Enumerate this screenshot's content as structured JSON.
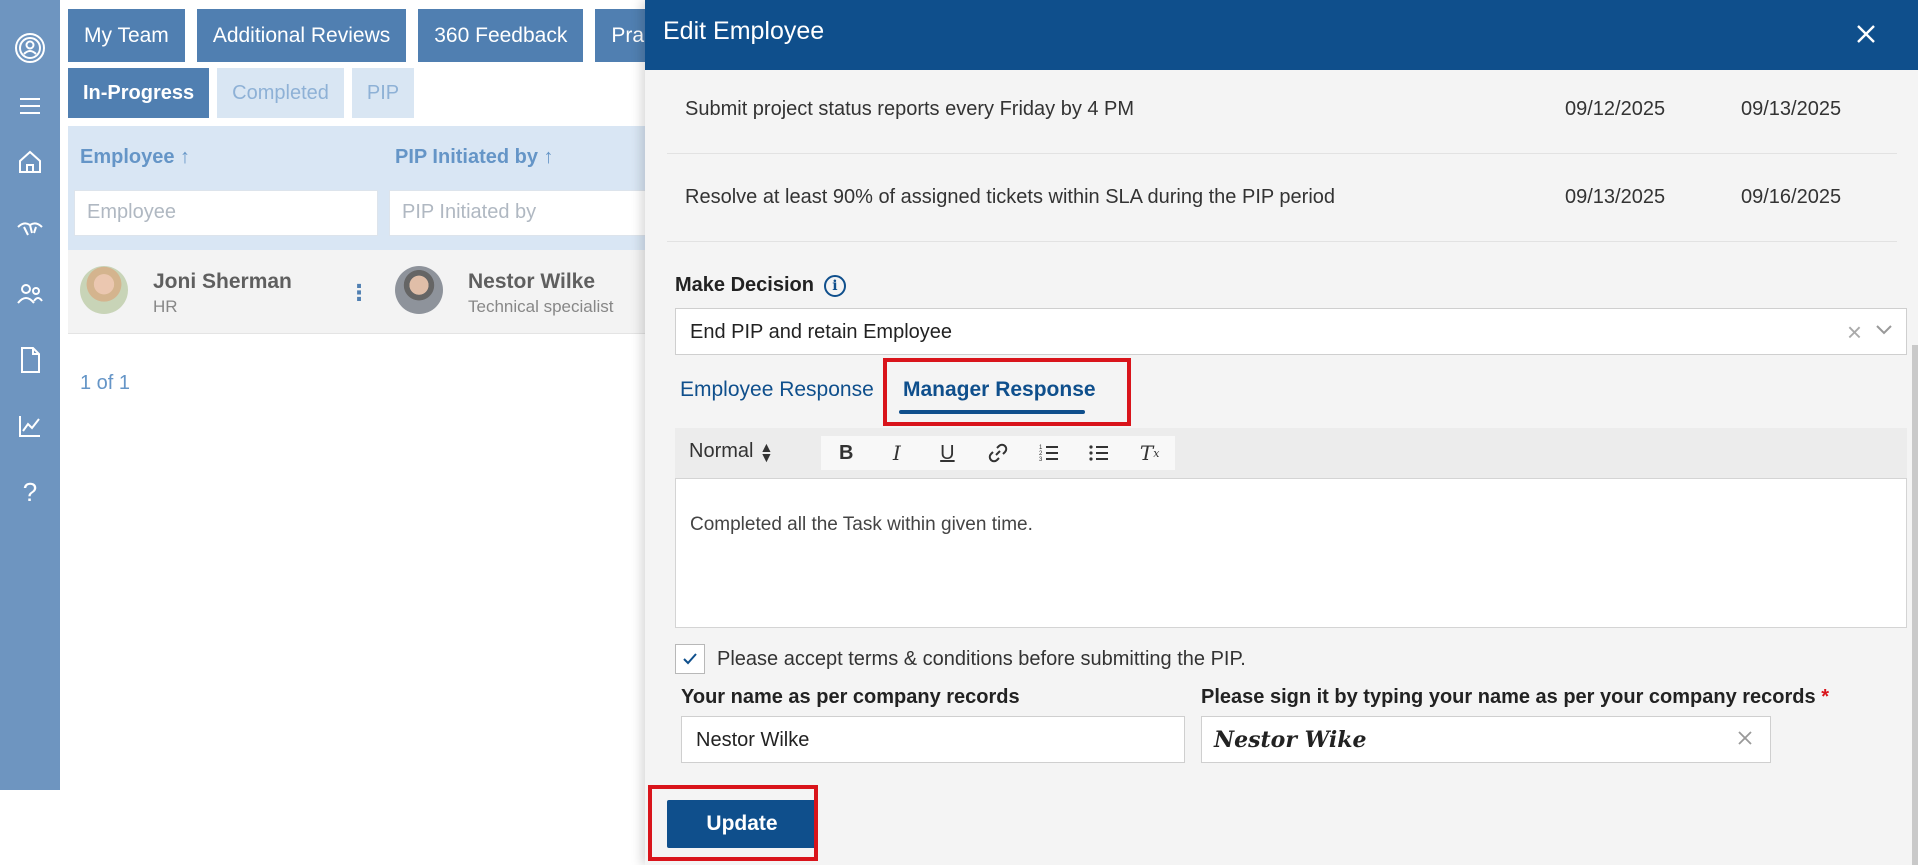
{
  "nav": {
    "icons": [
      "user-circle-icon",
      "menu-icon",
      "home-icon",
      "handshake-icon",
      "team-icon",
      "document-icon",
      "analytics-icon",
      "help-icon"
    ]
  },
  "background": {
    "top_tabs": [
      "My Team",
      "Additional Reviews",
      "360 Feedback",
      "Pra"
    ],
    "sub_tabs": [
      "In-Progress",
      "Completed",
      "PIP"
    ],
    "active_sub_tab": "In-Progress",
    "columns": [
      "Employee ↑",
      "PIP Initiated by ↑"
    ],
    "filters": [
      "Employee",
      "PIP Initiated by"
    ],
    "row": {
      "employee_name": "Joni Sherman",
      "employee_role": "HR",
      "initiator_name": "Nestor Wilke",
      "initiator_role": "Technical specialist"
    },
    "pager": "1 of 1"
  },
  "modal": {
    "title": "Edit Employee",
    "goals": [
      {
        "text": "Submit project status reports every Friday by 4 PM",
        "start": "09/12/2025",
        "end": "09/13/2025"
      },
      {
        "text": "Resolve at least 90% of assigned tickets within SLA during the PIP period",
        "start": "09/13/2025",
        "end": "09/16/2025"
      }
    ],
    "decision_label": "Make Decision",
    "decision_value": "End PIP and retain Employee",
    "response_tabs": {
      "employee": "Employee Response",
      "manager": "Manager Response"
    },
    "active_response_tab": "Manager Response",
    "editor": {
      "format": "Normal",
      "content": "Completed all the Task within given time."
    },
    "terms_label": "Please accept terms & conditions before submitting the PIP.",
    "terms_checked": true,
    "name_label": "Your name as per company records",
    "name_value": "Nestor Wilke",
    "sign_label": "Please sign it by typing your name as per your company records",
    "sign_required_mark": "*",
    "sign_value": "Nestor Wike",
    "update_button": "Update"
  },
  "colors": {
    "primary": "#0f4f8c",
    "highlight": "#d9141b",
    "nav": "#6e95c0"
  }
}
